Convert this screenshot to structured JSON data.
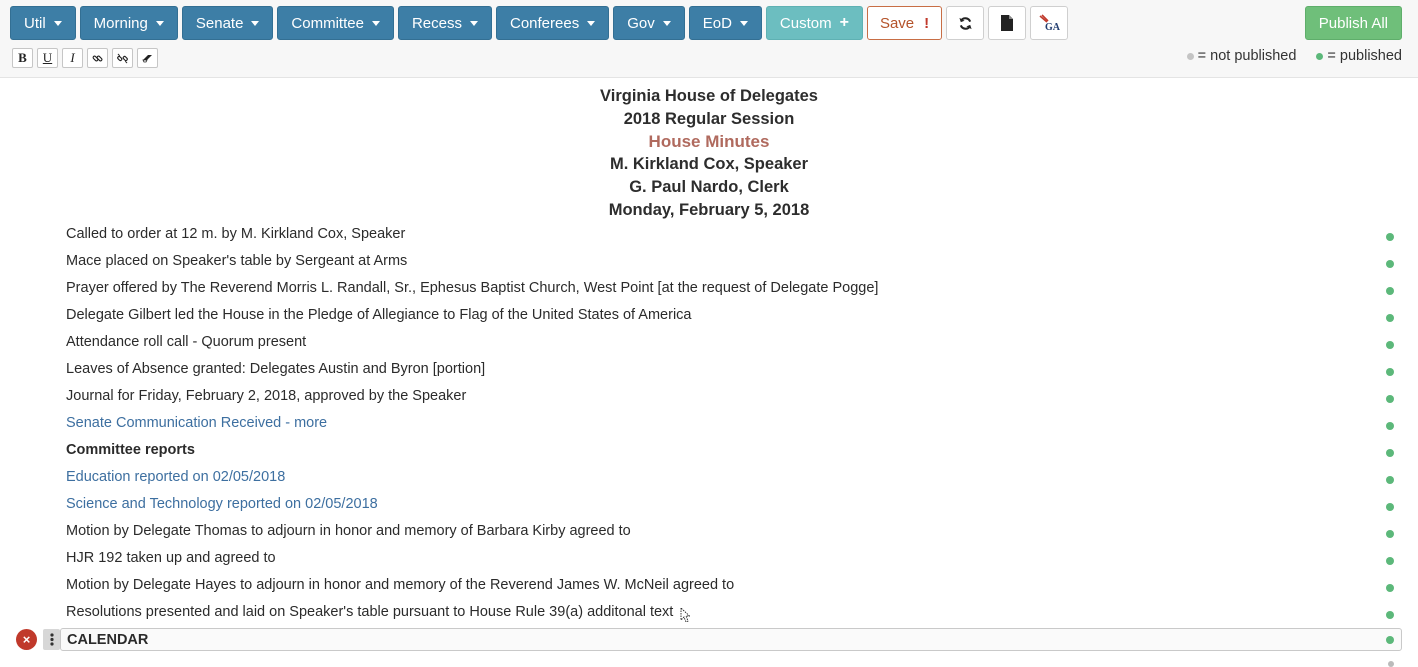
{
  "toolbar": {
    "dropdowns": [
      {
        "label": "Util"
      },
      {
        "label": "Morning"
      },
      {
        "label": "Senate"
      },
      {
        "label": "Committee"
      },
      {
        "label": "Recess"
      },
      {
        "label": "Conferees"
      },
      {
        "label": "Gov"
      },
      {
        "label": "EoD"
      }
    ],
    "custom_label": "Custom",
    "custom_icon": "+",
    "save_label": "Save",
    "save_icon": "!",
    "icons": [
      "refresh-icon",
      "document-icon",
      "ga-logo-icon"
    ],
    "publish_all_label": "Publish All"
  },
  "format": {
    "bold": "B",
    "underline": "U",
    "italic": "I",
    "link_icon": "link-icon",
    "unlink_icon": "unlink-icon",
    "eraser_icon": "eraser-icon"
  },
  "legend": {
    "not_published": "= not published",
    "published": "= published",
    "not_published_color": "#c4c4c4",
    "published_color": "#5cb87a"
  },
  "header": {
    "line1": "Virginia House of Delegates",
    "line2": "2018 Regular Session",
    "line3": "House Minutes",
    "line4": "M. Kirkland Cox, Speaker",
    "line5": "G. Paul Nardo, Clerk",
    "line6": "Monday, February 5, 2018"
  },
  "minutes": [
    {
      "text": "Called to order at 12 m. by M. Kirkland Cox, Speaker",
      "style": "plain"
    },
    {
      "text": "Mace placed on Speaker's table by Sergeant at Arms",
      "style": "plain"
    },
    {
      "text": "Prayer offered by The Reverend Morris L. Randall, Sr., Ephesus Baptist Church, West Point [at the request of Delegate Pogge]",
      "style": "plain"
    },
    {
      "text": "Delegate Gilbert led the House in the Pledge of Allegiance to Flag of the United States of America",
      "style": "plain"
    },
    {
      "text": "Attendance roll call - Quorum present",
      "style": "plain"
    },
    {
      "text": "Leaves of Absence granted: Delegates Austin and Byron [portion]",
      "style": "plain"
    },
    {
      "text": "Journal for Friday, February 2, 2018, approved by the Speaker",
      "style": "plain"
    },
    {
      "text": "Senate Communication Received - more",
      "style": "link"
    },
    {
      "text": "Committee reports",
      "style": "bold"
    },
    {
      "text": "Education reported on 02/05/2018",
      "style": "link"
    },
    {
      "text": "Science and Technology reported on 02/05/2018",
      "style": "link"
    },
    {
      "text": "Motion by Delegate Thomas to adjourn in honor and memory of Barbara Kirby agreed to",
      "style": "plain"
    },
    {
      "text": "HJR 192 taken up and agreed to",
      "style": "plain"
    },
    {
      "text": "Motion by Delegate Hayes to adjourn in honor and memory of the Reverend James W. McNeil agreed to",
      "style": "plain"
    },
    {
      "text": "Resolutions presented and laid on Speaker's table pursuant to House Rule 39(a) additonal text",
      "style": "plain"
    }
  ],
  "calendar": {
    "label": "CALENDAR",
    "delete_icon": "×"
  }
}
